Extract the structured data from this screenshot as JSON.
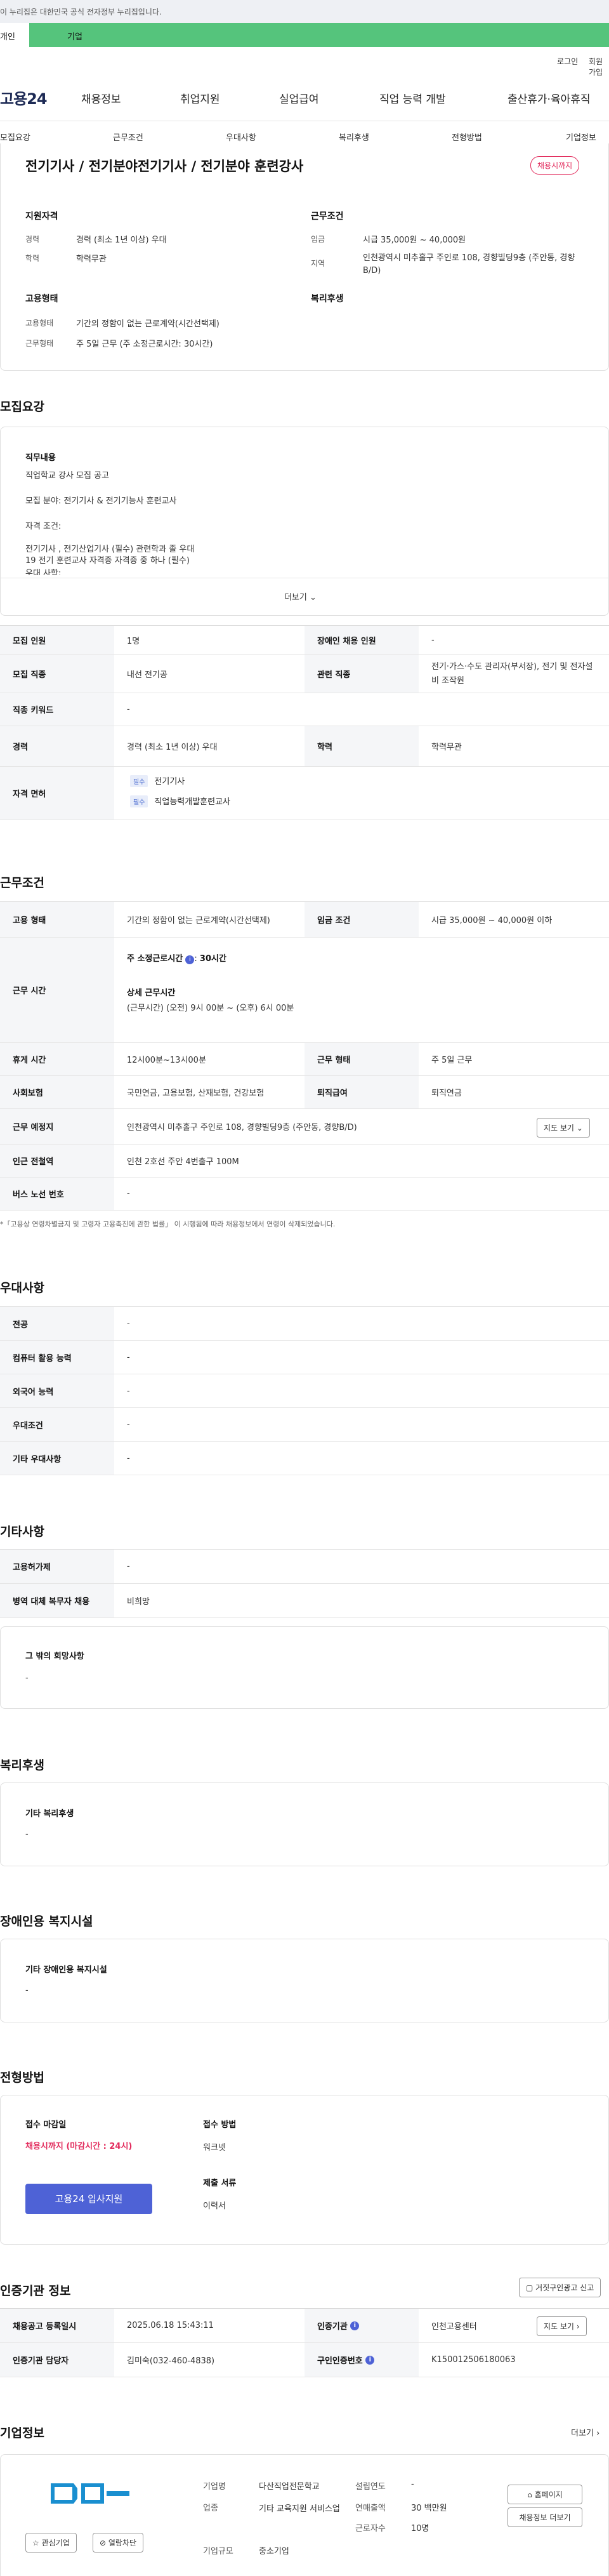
{
  "gov_banner": "이 누리집은 대한민국 공식 전자정부 누리집입니다.",
  "top_tabs": {
    "person": "개인",
    "company": "기업"
  },
  "util": {
    "login": "로그인",
    "join": "회원가입"
  },
  "logo": "고용24",
  "gnb": [
    "채용정보",
    "취업지원",
    "실업급여",
    "직업 능력 개발",
    "출산휴가·육아휴직"
  ],
  "lnb": [
    "모집요강",
    "근무조건",
    "우대사항",
    "복리후생",
    "전형방법",
    "기업정보"
  ],
  "summary": {
    "title": "전기기사 / 전기분야전기기사 / 전기분야 훈련강사",
    "badge": "채용시까지",
    "qual_title": "지원자격",
    "career_label": "경력",
    "career_value": "경력 (최소 1년 이상) 우대",
    "edu_label": "학력",
    "edu_value": "학력무관",
    "cond_title": "근무조건",
    "wage_label": "임금",
    "wage_value": "시급 35,000원 ~ 40,000원",
    "region_label": "지역",
    "region_value": "인천광역시 미추홀구 주인로 108, 경향빌딩9층 (주안동, 경향B/D)",
    "emp_title": "고용형태",
    "emp_label": "고용형태",
    "emp_value": "기간의 정함이 없는 근로계약(시간선택제)",
    "work_label": "근무형태",
    "work_value": "주 5일 근무 (주 소정근로시간: 30시간)",
    "welfare_title": "복리후생"
  },
  "recruit": {
    "title": "모집요강",
    "job_desc_title": "직무내용",
    "lines": [
      "직업학교 강사 모집 공고",
      "모집 분야: 전기기사 & 전기기능사 훈련교사",
      "자격 조건:",
      "전기기사 , 전기산업기사 (필수) 관련학과 졸 우대",
      "19 전기 훈련교사 자격증 자격증 중 하나 (필수)",
      "우대 사항:"
    ],
    "more": "더보기",
    "rows": {
      "count_label": "모집 인원",
      "count_value": "1명",
      "disabled_label": "장애인 채용 인원",
      "disabled_value": "-",
      "job_label": "모집 직종",
      "job_value": "내선 전기공",
      "related_label": "관련 직종",
      "related_value": "전기·가스·수도 관리자(부서장), 전기 및 전자설비 조작원",
      "keyword_label": "직종 키워드",
      "keyword_value": "-",
      "career_label": "경력",
      "career_value": "경력 (최소 1년 이상) 우대",
      "edu_label": "학력",
      "edu_value": "학력무관",
      "license_label": "자격 면허",
      "licenses": [
        {
          "tag": "필수",
          "name": "전기기사"
        },
        {
          "tag": "필수",
          "name": "직업능력개발훈련교사"
        }
      ]
    }
  },
  "work": {
    "title": "근무조건",
    "rows": {
      "emp_label": "고용 형태",
      "emp_value": "기간의 정함이 없는 근로계약(시간선택제)",
      "wage_label": "임금 조건",
      "wage_value": "시급 35,000원 ~ 40,000원 이하",
      "time_label": "근무 시간",
      "weekly_label": "주 소정근로시간",
      "weekly_value": "30시간",
      "detail_label": "상세 근무시간",
      "detail_value": "(근무시간) (오전) 9시 00분 ~ (오후) 6시 00분",
      "rest_label": "휴게 시간",
      "rest_value": "12시00분~13시00분",
      "type_label": "근무 형태",
      "type_value": "주 5일 근무",
      "ins_label": "사회보험",
      "ins_value": "국민연금, 고용보험, 산재보험, 건강보험",
      "sev_label": "퇴직급여",
      "sev_value": "퇴직연금",
      "place_label": "근무 예정지",
      "place_value": "인천광역시 미추홀구 주인로 108, 경향빌딩9층 (주안동, 경향B/D)",
      "map_btn": "지도 보기",
      "station_label": "인근 전철역",
      "station_value": "인천 2호선 주안 4번출구 100M",
      "bus_label": "버스 노선 번호",
      "bus_value": "-"
    },
    "note": "*「고용상 연령차별금지 및 고령자 고용촉진에 관한 법률」 이 시행됨에 따라 채용정보에서 연령이 삭제되었습니다."
  },
  "pref": {
    "title": "우대사항",
    "rows": [
      {
        "label": "전공",
        "value": "-"
      },
      {
        "label": "컴퓨터 활용 능력",
        "value": "-"
      },
      {
        "label": "외국어 능력",
        "value": "-"
      },
      {
        "label": "우대조건",
        "value": "-"
      },
      {
        "label": "기타 우대사항",
        "value": "-"
      }
    ]
  },
  "etc": {
    "title": "기타사항",
    "rows": [
      {
        "label": "고용허가제",
        "value": "-"
      },
      {
        "label": "병역 대체 복무자 채용",
        "value": "비희망"
      }
    ],
    "box_title": "그 밖의 희망사항",
    "box_value": "-"
  },
  "welfare": {
    "title": "복리후생",
    "box_title": "기타 복리후생",
    "box_value": "-"
  },
  "disabled": {
    "title": "장애인용 복지시설",
    "box_title": "기타 장애인용 복지시설",
    "box_value": "-"
  },
  "process": {
    "title": "전형방법",
    "deadline_label": "접수 마감일",
    "deadline_value": "채용시까지 (마감시간 : 24시)",
    "apply_btn": "고용24 입사지원",
    "method_label": "접수 방법",
    "method_value": "워크넷",
    "docs_label": "제출 서류",
    "docs_value": "이력서"
  },
  "cert": {
    "title": "인증기관 정보",
    "report_btn": "거짓구인광고 신고",
    "reg_label": "채용공고 등록일시",
    "reg_value": "2025.06.18 15:43:11",
    "org_label": "인증기관",
    "org_value": "인천고용센터",
    "map_btn": "지도 보기",
    "manager_label": "인증기관 담당자",
    "manager_value": "김미숙(032-460-4838)",
    "id_label": "구인인증번호",
    "id_value": "K150012506180063"
  },
  "company": {
    "title": "기업정보",
    "more": "더보기",
    "interest_btn": "관심기업",
    "block_btn": "열람차단",
    "name_label": "기업명",
    "name_value": "다산직업전문학교",
    "industry_label": "업종",
    "industry_value": "기타 교육지원 서비스업",
    "size_label": "기업규모",
    "size_value": "중소기업",
    "founded_label": "설립연도",
    "founded_value": "-",
    "sales_label": "연매출액",
    "sales_value": "30 백만원",
    "staff_label": "근로자수",
    "staff_value": "10명",
    "home_btn": "홈페이지",
    "recruit_btn": "채용정보 더보기"
  }
}
